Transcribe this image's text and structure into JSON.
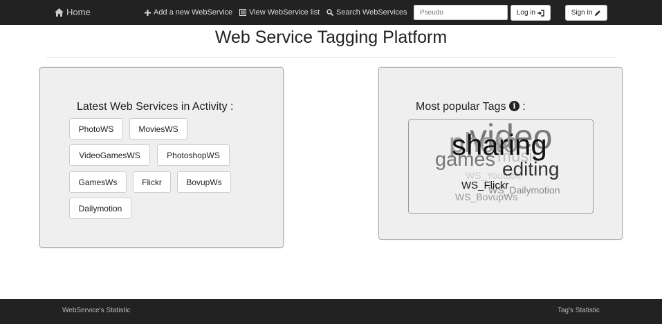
{
  "nav": {
    "home": "Home",
    "add": "Add a new WebService",
    "view": "View WebService list",
    "search": "Search WebServices",
    "pseudo_placeholder": "Pseudo",
    "login": "Log in",
    "signin": "Sign in"
  },
  "page_title": "Web Service Tagging Platform",
  "latest": {
    "heading": "Latest Web Services in Activity :",
    "services": [
      "PhotoWS",
      "MoviesWS",
      "VideoGamesWS",
      "PhotoshopWS",
      "GamesWs",
      "Flickr",
      "BovupWs",
      "Dailymotion"
    ]
  },
  "popular": {
    "heading": "Most popular Tags",
    "suffix": ":",
    "info_icon": "info-icon",
    "tags": [
      {
        "text": "video",
        "color": "#777777"
      },
      {
        "text": "photo",
        "color": "#9a9a9a"
      },
      {
        "text": "music",
        "color": "#c2c2c2"
      },
      {
        "text": "games",
        "color": "#777777"
      },
      {
        "text": "WS_Youtube",
        "color": "#cccccc"
      },
      {
        "text": "WS_Dailymotion",
        "color": "#888888"
      },
      {
        "text": "WS_BovupWs",
        "color": "#999999"
      },
      {
        "text": "sharing",
        "color": "#111111"
      },
      {
        "text": "editing",
        "color": "#333333"
      },
      {
        "text": "WS_Flickr",
        "color": "#111111"
      }
    ]
  },
  "footer": {
    "left": "WebService's Statistic",
    "right": "Tag's Statistic"
  }
}
